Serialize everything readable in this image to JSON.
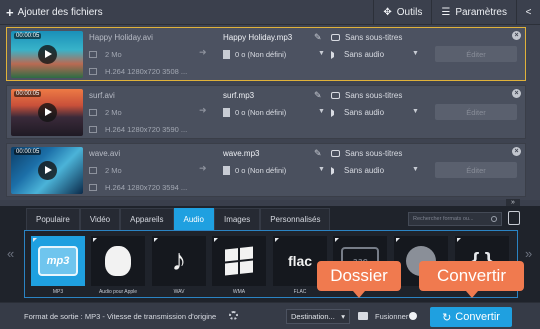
{
  "toolbar": {
    "add_files": "Ajouter des fichiers",
    "tools": "Outils",
    "settings": "Paramètres"
  },
  "files": [
    {
      "duration": "00:00:05",
      "source_name": "Happy Holiday.avi",
      "source_size": "2 Mo",
      "source_codec": "H.264 1280x720 3508 ...",
      "output_name": "Happy Holiday.mp3",
      "output_size": "0 o (Non défini)",
      "subtitles": "Sans sous-titres",
      "audio": "Sans audio",
      "edit": "Éditer"
    },
    {
      "duration": "00:00:05",
      "source_name": "surf.avi",
      "source_size": "2 Mo",
      "source_codec": "H.264 1280x720 3590 ...",
      "output_name": "surf.mp3",
      "output_size": "0 o (Non défini)",
      "subtitles": "Sans sous-titres",
      "audio": "Sans audio",
      "edit": "Éditer"
    },
    {
      "duration": "00:00:05",
      "source_name": "wave.avi",
      "source_size": "2 Mo",
      "source_codec": "H.264 1280x720 3594 ...",
      "output_name": "wave.mp3",
      "output_size": "0 o (Non défini)",
      "subtitles": "Sans sous-titres",
      "audio": "Sans audio",
      "edit": "Éditer"
    }
  ],
  "format_tabs": [
    "Populaire",
    "Vidéo",
    "Appareils",
    "Audio",
    "Images",
    "Personnalisés"
  ],
  "active_tab": "Audio",
  "search_placeholder": "Rechercher formats ou...",
  "formats": [
    {
      "label": "MP3",
      "icon": "mp3-icon",
      "text": "mp3",
      "selected": true
    },
    {
      "label": "Audio pour Apple",
      "icon": "apple-icon",
      "selected": false
    },
    {
      "label": "WAV",
      "icon": "music-note-icon",
      "selected": false
    },
    {
      "label": "WMA",
      "icon": "windows-icon",
      "selected": false
    },
    {
      "label": "FLAC",
      "icon": "flac-icon",
      "text": "flac",
      "selected": false
    },
    {
      "label": "",
      "icon": "aac-icon",
      "text": "aac",
      "selected": false
    },
    {
      "label": "",
      "icon": "disc-icon",
      "selected": false
    },
    {
      "label": "",
      "icon": "braces-icon",
      "selected": false
    }
  ],
  "callouts": {
    "folder": "Dossier",
    "convert": "Convertir"
  },
  "bottom": {
    "output_format": "Format de sortie : MP3 - Vitesse de transmission d'origine",
    "destination": "Destination...",
    "merge": "Fusionner",
    "convert": "Convertir"
  },
  "colors": {
    "accent": "#1fa0e0",
    "selection_border": "#e0b23a",
    "callout": "#f07a4f"
  }
}
